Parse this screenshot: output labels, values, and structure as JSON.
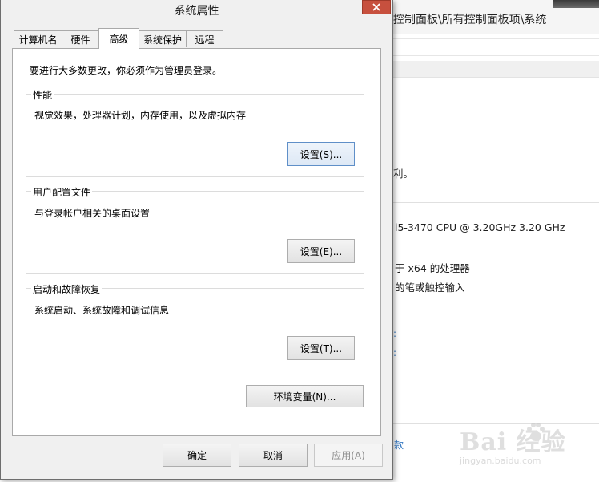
{
  "background_window": {
    "breadcrumb": "控制面板\\所有控制面板项\\系统",
    "text_rights": "利。",
    "processor_text": "i5-3470 CPU @ 3.20GHz   3.20 GHz",
    "system_type_text": "于 x64 的处理器",
    "pen_touch_text": "的笔或触控输入",
    "bottom_link": "款",
    "watermark_main": "Bai 经验",
    "watermark_sub": "jingyan.baidu.com"
  },
  "dialog": {
    "title": "系统属性",
    "tabs": [
      {
        "label": "计算机名",
        "active": false
      },
      {
        "label": "硬件",
        "active": false
      },
      {
        "label": "高级",
        "active": true
      },
      {
        "label": "系统保护",
        "active": false
      },
      {
        "label": "远程",
        "active": false
      }
    ],
    "admin_note": "要进行大多数更改，你必须作为管理员登录。",
    "performance": {
      "legend": "性能",
      "description": "视觉效果，处理器计划，内存使用，以及虚拟内存",
      "button": "设置(S)..."
    },
    "user_profiles": {
      "legend": "用户配置文件",
      "description": "与登录帐户相关的桌面设置",
      "button": "设置(E)..."
    },
    "startup_recovery": {
      "legend": "启动和故障恢复",
      "description": "系统启动、系统故障和调试信息",
      "button": "设置(T)..."
    },
    "env_vars_button": "环境变量(N)...",
    "ok_button": "确定",
    "cancel_button": "取消",
    "apply_button": "应用(A)"
  },
  "colors": {
    "close_button": "#c7503e",
    "link": "#3a7cc4",
    "focus_border": "#5f8fc8"
  }
}
